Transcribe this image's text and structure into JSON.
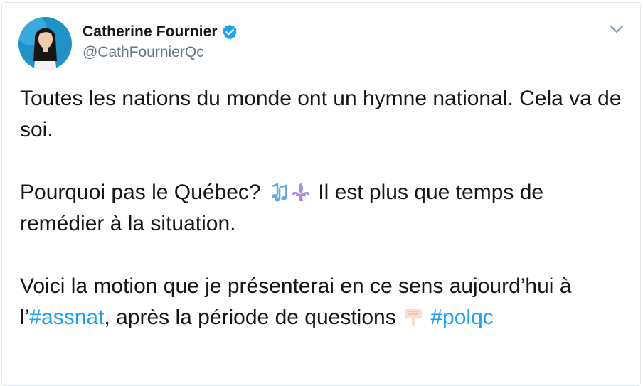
{
  "tweet": {
    "author": {
      "display_name": "Catherine Fournier",
      "handle": "@CathFournierQc",
      "verified": true,
      "avatar_icon": "profile-photo"
    },
    "menu_icon": "chevron-down-icon",
    "text": {
      "p1": "Toutes les nations du monde ont un hymne national. Cela va de soi.",
      "p2_before": "Pourquoi pas le Québec? ",
      "p2_emoji_1": "musical-notes-emoji",
      "p2_emoji_2": "fleur-de-lis-emoji",
      "p2_after": " Il est plus que temps de remédier à la situation.",
      "p3_before": "Voici la motion que je présenterai en ce sens aujourd’hui à l’",
      "p3_hashtag_1": "#assnat",
      "p3_after": ", après la période de questions ",
      "p3_emoji": "backhand-index-pointing-down-emoji",
      "p3_hashtag_2": "#polqc"
    }
  },
  "colors": {
    "text": "#14171a",
    "secondary_text": "#657786",
    "link": "#1da1f2",
    "border": "#e1e8ed",
    "verified": "#1da1f2"
  }
}
